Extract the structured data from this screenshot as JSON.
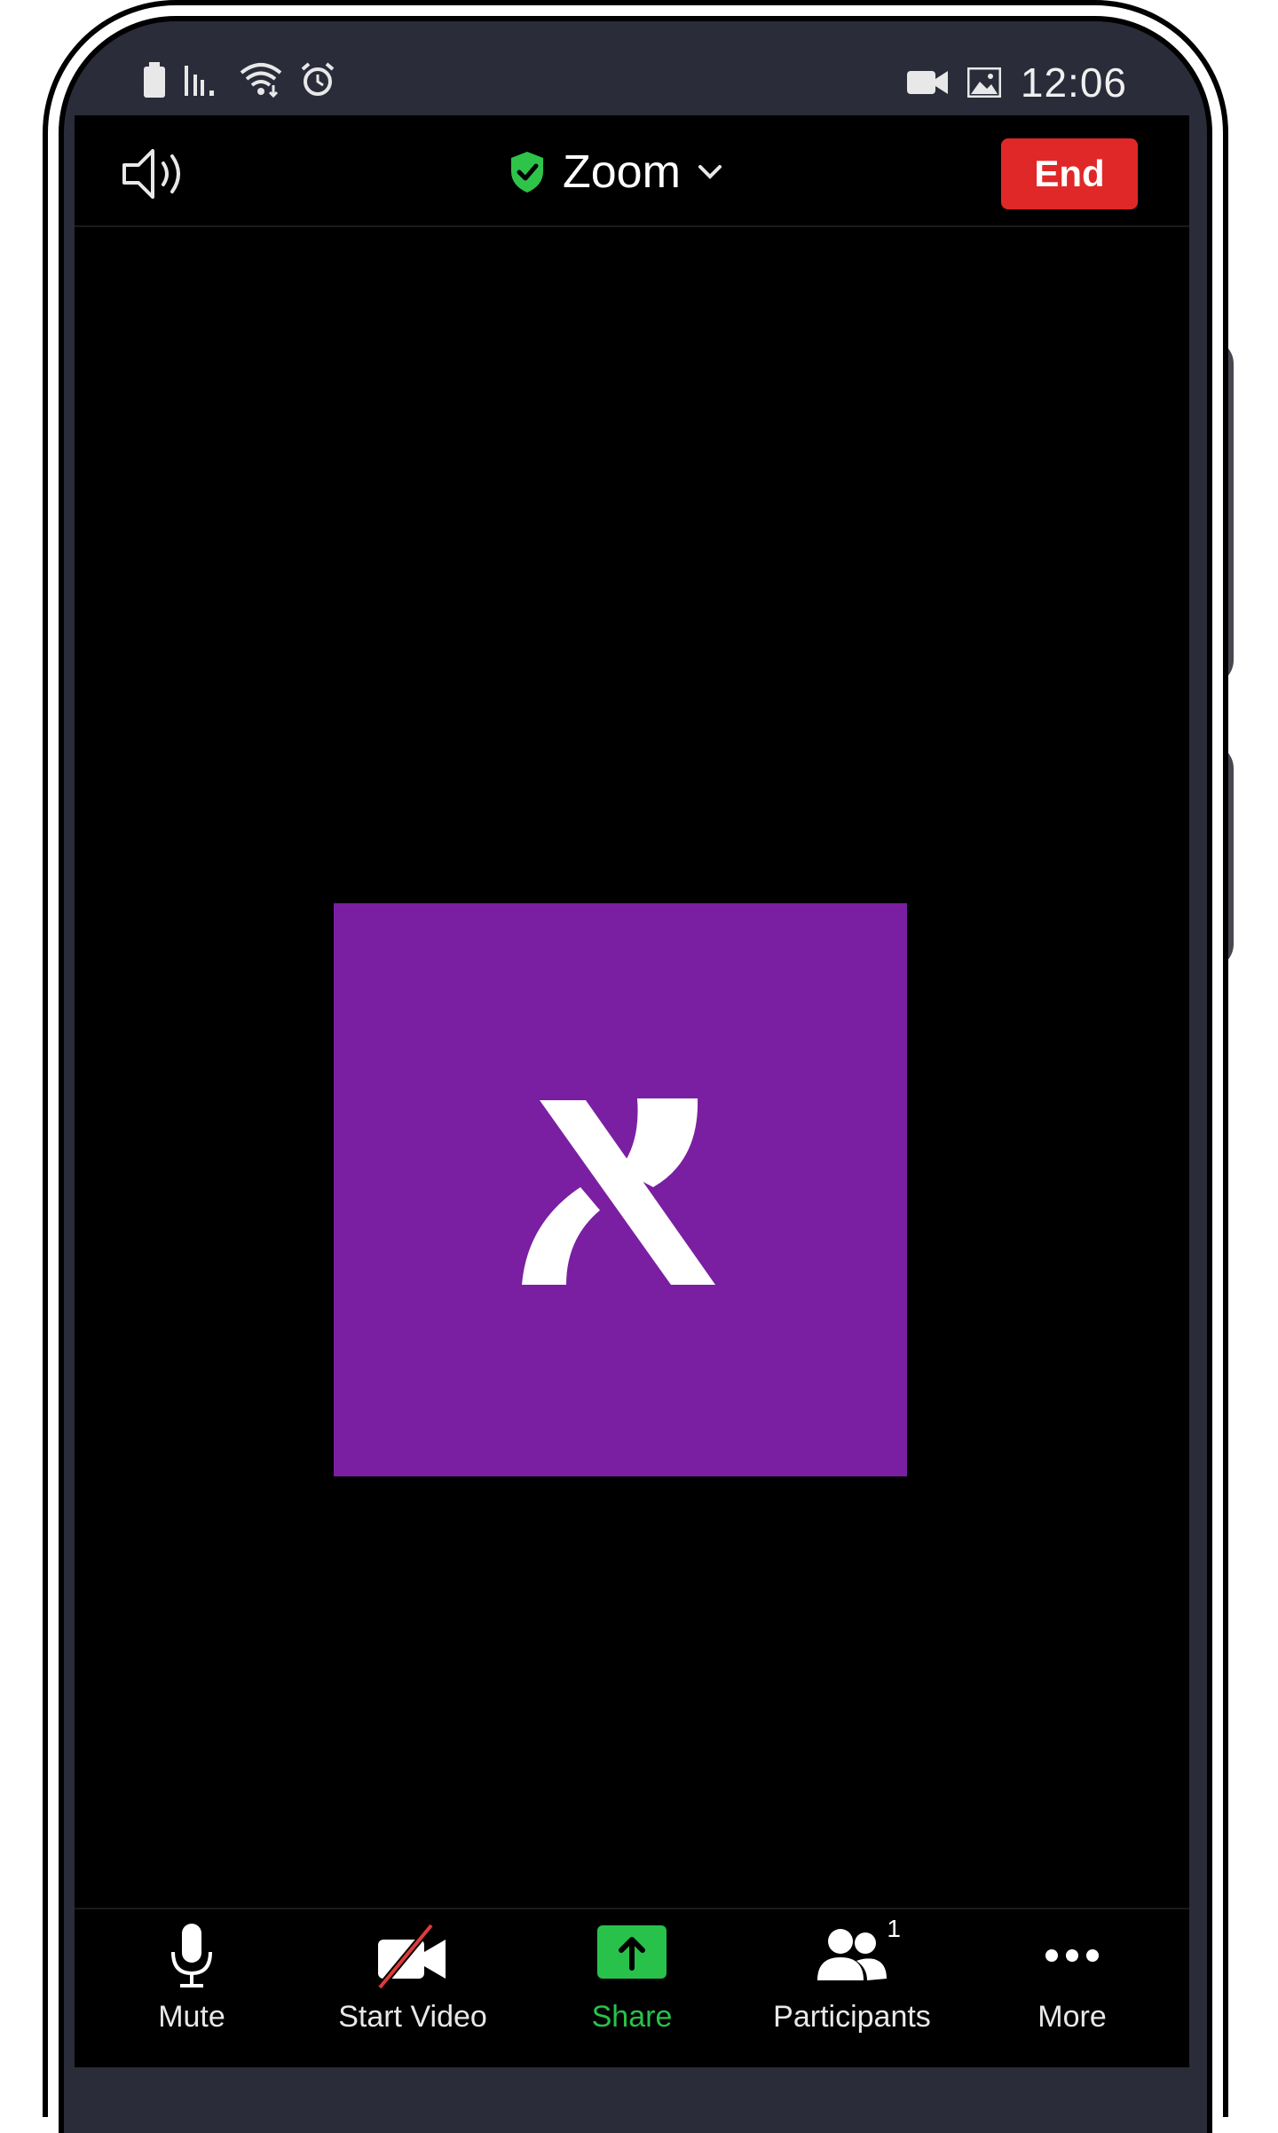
{
  "status_bar": {
    "time": "12:06",
    "icons_left": [
      "battery-icon",
      "signal-icon",
      "wifi-icon",
      "alarm-icon"
    ],
    "icons_right": [
      "video-camera-icon",
      "image-icon"
    ]
  },
  "header": {
    "title": "Zoom",
    "end_label": "End",
    "shield_color": "#2ec44a",
    "end_color": "#e02828"
  },
  "participant": {
    "initial": "א",
    "avatar_color": "#7a1fa2"
  },
  "toolbar": {
    "mute_label": "Mute",
    "start_video_label": "Start Video",
    "share_label": "Share",
    "participants_label": "Participants",
    "participants_count": "1",
    "more_label": "More",
    "share_color": "#28c24a"
  }
}
